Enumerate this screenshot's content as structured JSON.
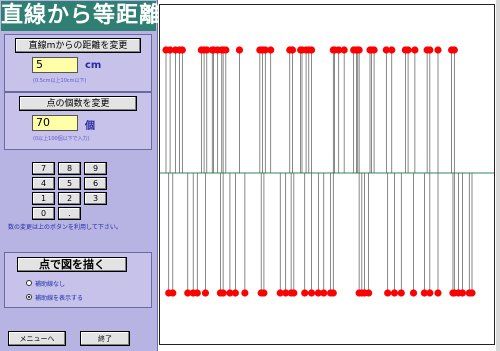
{
  "title": "直線から等距離",
  "distance_group": {
    "button_label": "直線mからの距離を変更",
    "value": "5",
    "unit": "cm",
    "hint": "(0.5cm以上10cm以下)"
  },
  "points_group": {
    "button_label": "点の個数を変更",
    "value": "70",
    "unit": "個",
    "hint": "(0以上100個以下で入力)"
  },
  "keypad": {
    "keys": [
      "7",
      "8",
      "9",
      "4",
      "5",
      "6",
      "1",
      "2",
      "3",
      "0",
      "."
    ]
  },
  "note": "数の変更は上のボタンを利用して下さい。",
  "draw_group": {
    "button_label": "点で図を描く",
    "options": [
      {
        "label": "補助線なし",
        "selected": false
      },
      {
        "label": "補助線を表示する",
        "selected": true
      }
    ]
  },
  "footer": {
    "menu_label": "メニューへ",
    "end_label": "終了"
  },
  "colors": {
    "title_bg": "#2f7f72",
    "panel_bg": "#b7b3e2",
    "point": "#ff0000",
    "aux_line": "#555555",
    "center_line": "#2e8b57"
  },
  "plot": {
    "point_count": 70,
    "top_points": [
      0,
      3,
      7,
      10,
      12,
      26,
      28,
      30,
      34,
      35,
      38,
      41,
      42,
      44,
      54,
      69,
      71,
      73,
      77,
      91,
      93,
      99,
      100,
      103,
      105,
      107,
      123,
      124,
      127,
      131,
      138,
      140,
      141,
      142,
      150,
      151,
      153,
      162,
      166,
      176,
      178,
      183,
      192,
      194,
      200,
      210,
      212
    ],
    "bottom_points": [
      2,
      5,
      16,
      20,
      23,
      29,
      40,
      42,
      47,
      51,
      58,
      70,
      72,
      84,
      88,
      92,
      94,
      102,
      107,
      112,
      116,
      121,
      123,
      142,
      144,
      146,
      149,
      163,
      168,
      173,
      182,
      190,
      194,
      200,
      211,
      212,
      215,
      218,
      223,
      225
    ]
  }
}
